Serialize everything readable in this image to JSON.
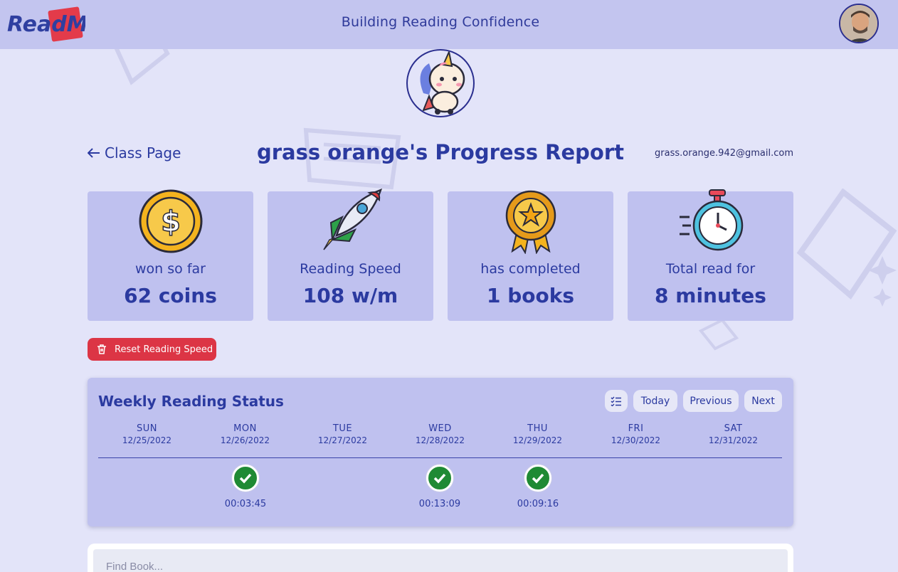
{
  "header": {
    "logo_text": "ReadM",
    "title": "Building Reading Confidence"
  },
  "report": {
    "back_label": "Class Page",
    "title": "grass orange's Progress Report",
    "email": "grass.orange.942@gmail.com"
  },
  "stats": [
    {
      "label": "won so far",
      "value": "62 coins",
      "icon": "coin-icon"
    },
    {
      "label": "Reading Speed",
      "value": "108 w/m",
      "icon": "rocket-icon"
    },
    {
      "label": "has completed",
      "value": "1 books",
      "icon": "medal-icon"
    },
    {
      "label": "Total read for",
      "value": "8 minutes",
      "icon": "stopwatch-icon"
    }
  ],
  "reset_label": "Reset Reading Speed",
  "weekly": {
    "title": "Weekly Reading Status",
    "today_label": "Today",
    "previous_label": "Previous",
    "next_label": "Next",
    "days": [
      {
        "name": "SUN",
        "date": "12/25/2022",
        "completed": false,
        "duration": ""
      },
      {
        "name": "MON",
        "date": "12/26/2022",
        "completed": true,
        "duration": "00:03:45"
      },
      {
        "name": "TUE",
        "date": "12/27/2022",
        "completed": false,
        "duration": ""
      },
      {
        "name": "WED",
        "date": "12/28/2022",
        "completed": true,
        "duration": "00:13:09"
      },
      {
        "name": "THU",
        "date": "12/29/2022",
        "completed": true,
        "duration": "00:09:16"
      },
      {
        "name": "FRI",
        "date": "12/30/2022",
        "completed": false,
        "duration": ""
      },
      {
        "name": "SAT",
        "date": "12/31/2022",
        "completed": false,
        "duration": ""
      }
    ]
  },
  "search": {
    "placeholder": "Find Book..."
  },
  "colors": {
    "accent": "#2b3aa0",
    "card": "#bfc1ef",
    "danger": "#dc3545",
    "success": "#1f8a34"
  }
}
